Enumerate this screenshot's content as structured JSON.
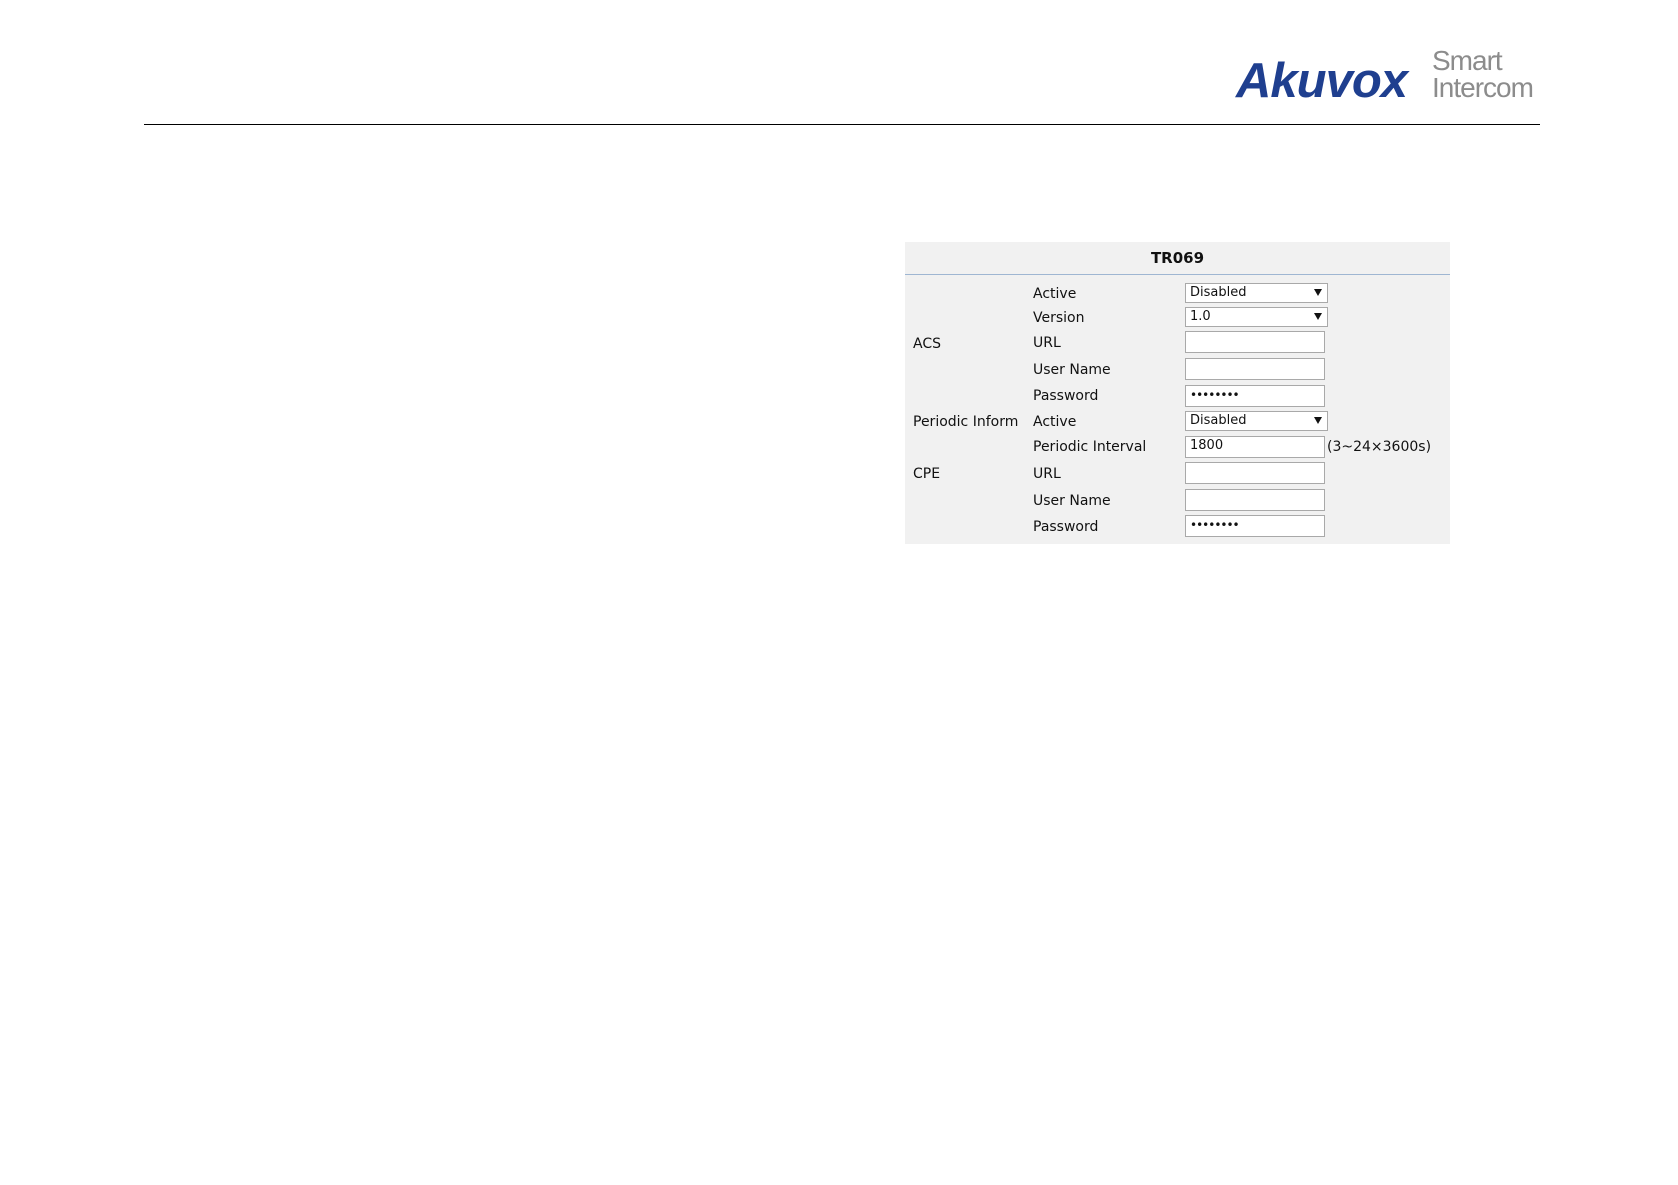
{
  "brand": {
    "main": "Akuvox",
    "sub_line1": "Smart",
    "sub_line2": "Intercom",
    "main_color": "#1f3f8f",
    "sub_color": "#8c8c8c"
  },
  "panel": {
    "title": "TR069",
    "background": "#f1f1f1",
    "groups": {
      "acs": "ACS",
      "periodic": "Periodic Inform",
      "cpe": "CPE"
    },
    "acs": {
      "active": {
        "label": "Active",
        "value": "Disabled"
      },
      "version": {
        "label": "Version",
        "value": "1.0"
      },
      "url": {
        "label": "URL",
        "value": ""
      },
      "username": {
        "label": "User Name",
        "value": ""
      },
      "password": {
        "label": "Password",
        "value": "••••••••"
      }
    },
    "periodic": {
      "active": {
        "label": "Active",
        "value": "Disabled"
      },
      "interval": {
        "label": "Periodic Interval",
        "value": "1800",
        "hint": "(3~24×3600s)"
      }
    },
    "cpe": {
      "url": {
        "label": "URL",
        "value": ""
      },
      "username": {
        "label": "User Name",
        "value": ""
      },
      "password": {
        "label": "Password",
        "value": "••••••••"
      }
    }
  }
}
